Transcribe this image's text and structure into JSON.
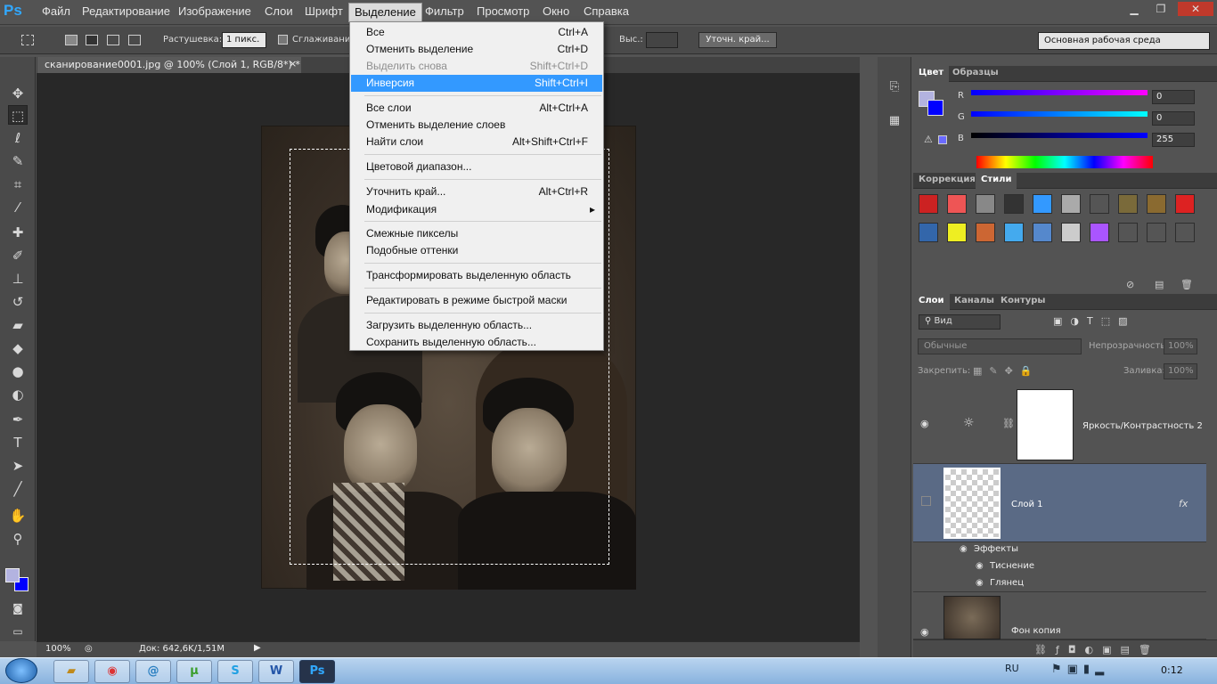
{
  "app": {
    "logo": "Ps"
  },
  "menubar": {
    "items": [
      "Файл",
      "Редактирование",
      "Изображение",
      "Слои",
      "Шрифт",
      "Выделение",
      "Фильтр",
      "Просмотр",
      "Окно",
      "Справка"
    ]
  },
  "window_controls": {
    "minimize": "▁",
    "restore": "❐",
    "close": "✕"
  },
  "options_bar": {
    "feather_label": "Растушевка:",
    "feather_value": "1 пикс.",
    "antialias_label": "Сглаживание",
    "height_label": "Выс.:",
    "refine_edge_button": "Уточн. край...",
    "workspace": "Основная рабочая среда"
  },
  "document": {
    "tab_title": "сканирование0001.jpg @ 100% (Слой 1, RGB/8*) *",
    "tab_close": "×"
  },
  "status_bar": {
    "zoom": "100%",
    "doc_info": "Док: 642,6K/1,51M"
  },
  "select_menu": {
    "items": [
      {
        "label": "Все",
        "shortcut": "Ctrl+A"
      },
      {
        "label": "Отменить выделение",
        "shortcut": "Ctrl+D"
      },
      {
        "label": "Выделить снова",
        "shortcut": "Shift+Ctrl+D"
      },
      {
        "label": "Инверсия",
        "shortcut": "Shift+Ctrl+I"
      },
      {
        "label": "Все слои",
        "shortcut": "Alt+Ctrl+A"
      },
      {
        "label": "Отменить выделение слоев",
        "shortcut": ""
      },
      {
        "label": "Найти слои",
        "shortcut": "Alt+Shift+Ctrl+F"
      },
      {
        "label": "Цветовой диапазон...",
        "shortcut": ""
      },
      {
        "label": "Уточнить край...",
        "shortcut": "Alt+Ctrl+R"
      },
      {
        "label": "Модификация",
        "shortcut": "▸"
      },
      {
        "label": "Смежные пикселы",
        "shortcut": ""
      },
      {
        "label": "Подобные оттенки",
        "shortcut": ""
      },
      {
        "label": "Трансформировать выделенную область",
        "shortcut": ""
      },
      {
        "label": "Редактировать в режиме быстрой маски",
        "shortcut": ""
      },
      {
        "label": "Загрузить выделенную область...",
        "shortcut": ""
      },
      {
        "label": "Сохранить выделенную область...",
        "shortcut": ""
      }
    ]
  },
  "color_panel": {
    "tabs": [
      "Цвет",
      "Образцы"
    ],
    "r_label": "R",
    "r_value": "0",
    "g_label": "G",
    "g_value": "0",
    "b_label": "B",
    "b_value": "255"
  },
  "styles_panel": {
    "tabs": [
      "Коррекция",
      "Стили"
    ]
  },
  "layers_panel": {
    "tabs": [
      "Слои",
      "Каналы",
      "Контуры"
    ],
    "kind_filter": "Вид",
    "blend_mode": "Обычные",
    "opacity_label": "Непрозрачность:",
    "opacity_value": "100%",
    "lock_label": "Закрепить:",
    "fill_label": "Заливка:",
    "fill_value": "100%",
    "layers": [
      {
        "name": "Яркость/Контрастность 2"
      },
      {
        "name": "Слой 1",
        "fx": "fx"
      },
      {
        "name": "Фон копия"
      }
    ],
    "effects_label": "Эффекты",
    "effects": [
      "Тиснение",
      "Глянец"
    ]
  },
  "taskbar": {
    "lang": "RU",
    "time": "0:12"
  }
}
